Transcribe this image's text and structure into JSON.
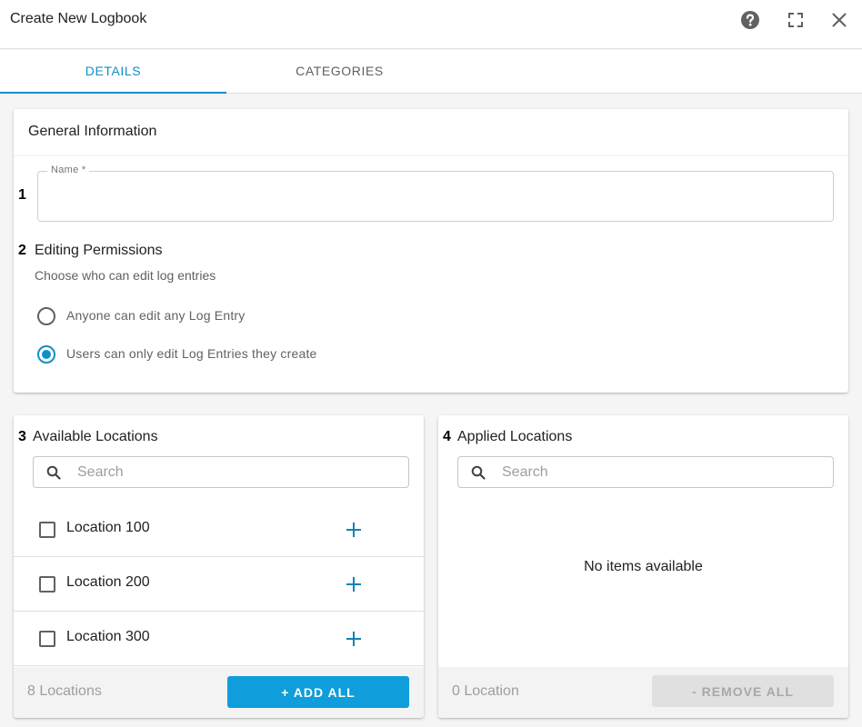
{
  "dialog": {
    "title": "Create New Logbook",
    "icons": [
      "help-icon",
      "fullscreen-icon",
      "close-icon"
    ]
  },
  "tabs": [
    {
      "label": "DETAILS",
      "active": true
    },
    {
      "label": "CATEGORIES",
      "active": false
    }
  ],
  "general": {
    "title": "General Information",
    "name_number": "1",
    "name_label": "Name *",
    "name_value": "",
    "permissions_number": "2",
    "permissions_title": "Editing Permissions",
    "permissions_subtitle": "Choose who can edit log entries",
    "options": [
      {
        "label": "Anyone can edit any Log Entry",
        "selected": false
      },
      {
        "label": "Users can only edit Log Entries they create",
        "selected": true
      }
    ]
  },
  "available": {
    "number": "3",
    "title": "Available Locations",
    "search_placeholder": "Search",
    "items": [
      {
        "label": "Location 100",
        "checked": false
      },
      {
        "label": "Location 200",
        "checked": false
      },
      {
        "label": "Location 300",
        "checked": false
      }
    ],
    "count": "8 Locations",
    "add_all_label": "+ ADD ALL"
  },
  "applied": {
    "number": "4",
    "title": "Applied Locations",
    "search_placeholder": "Search",
    "empty_text": "No items available",
    "count": "0 Location",
    "remove_all_label": "- REMOVE ALL"
  },
  "colors": {
    "accent": "#0f8fc9",
    "button": "#0f9ddb",
    "plus": "#1581b8",
    "disabled_button": "#e0e0e0"
  }
}
